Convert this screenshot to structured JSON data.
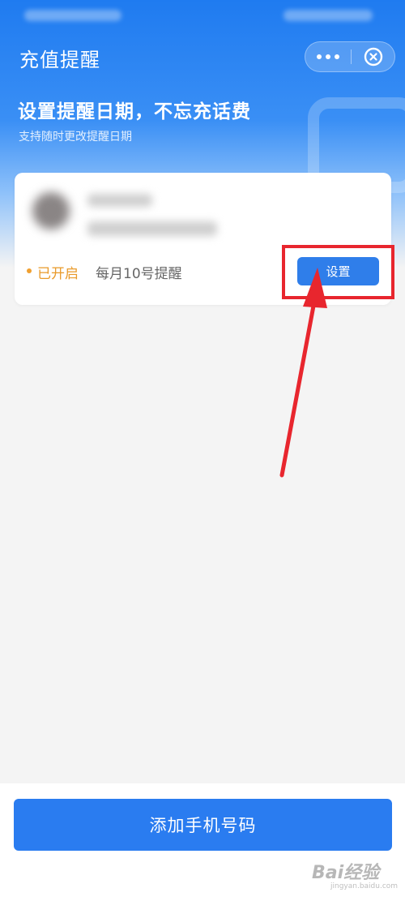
{
  "header": {
    "title": "充值提醒",
    "more_icon": "more-dots-icon",
    "close_icon": "close-circle-icon"
  },
  "hero": {
    "title": "设置提醒日期，不忘充话费",
    "subtitle": "支持随时更改提醒日期"
  },
  "card": {
    "status": "已开启",
    "schedule": "每月10号提醒",
    "set_button": "设置"
  },
  "footer": {
    "add_button": "添加手机号码"
  },
  "watermark": {
    "logo": "Bai经验",
    "url": "jingyan.baidu.com"
  },
  "colors": {
    "primary_blue": "#2a7cf0",
    "status_orange": "#e99a2a",
    "annotation_red": "#e8262e"
  }
}
